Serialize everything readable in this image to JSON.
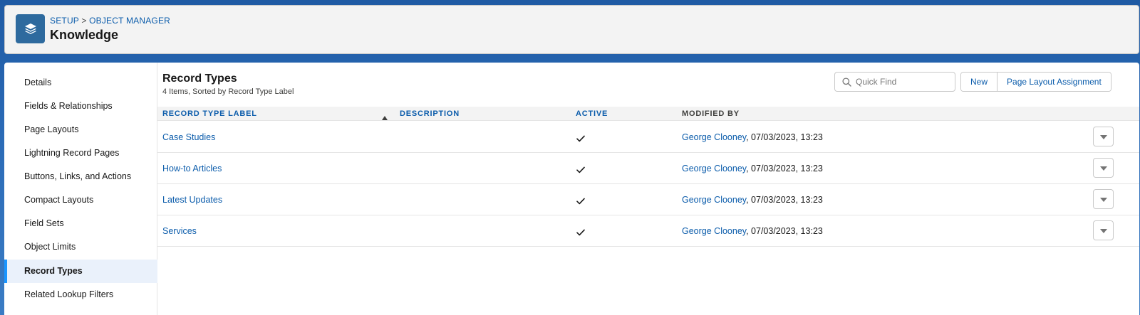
{
  "header": {
    "breadcrumb": {
      "setup": "SETUP",
      "separator": ">",
      "object_manager": "OBJECT MANAGER"
    },
    "title": "Knowledge",
    "icon": "stack-layers-icon"
  },
  "sidebar": {
    "items": [
      {
        "label": "Details"
      },
      {
        "label": "Fields & Relationships"
      },
      {
        "label": "Page Layouts"
      },
      {
        "label": "Lightning Record Pages"
      },
      {
        "label": "Buttons, Links, and Actions"
      },
      {
        "label": "Compact Layouts"
      },
      {
        "label": "Field Sets"
      },
      {
        "label": "Object Limits"
      },
      {
        "label": "Record Types",
        "active": true
      },
      {
        "label": "Related Lookup Filters"
      }
    ]
  },
  "content": {
    "title": "Record Types",
    "subtitle": "4 Items, Sorted by Record Type Label",
    "search": {
      "placeholder": "Quick Find",
      "value": ""
    },
    "buttons": {
      "new": "New",
      "page_layout_assignment": "Page Layout Assignment"
    },
    "table": {
      "headers": {
        "label": "RECORD TYPE LABEL",
        "description": "DESCRIPTION",
        "active": "ACTIVE",
        "modified_by": "MODIFIED BY"
      },
      "rows": [
        {
          "label": "Case Studies",
          "description": "",
          "active": true,
          "modified_by": "George Clooney",
          "modified_date": ", 07/03/2023, 13:23"
        },
        {
          "label": "How-to Articles",
          "description": "",
          "active": true,
          "modified_by": "George Clooney",
          "modified_date": ", 07/03/2023, 13:23"
        },
        {
          "label": "Latest Updates",
          "description": "",
          "active": true,
          "modified_by": "George Clooney",
          "modified_date": ", 07/03/2023, 13:23"
        },
        {
          "label": "Services",
          "description": "",
          "active": true,
          "modified_by": "George Clooney",
          "modified_date": ", 07/03/2023, 13:23"
        }
      ]
    }
  },
  "colors": {
    "link": "#0b5cab",
    "accent": "#1b96ff",
    "object_icon": "#2e6a9e"
  }
}
